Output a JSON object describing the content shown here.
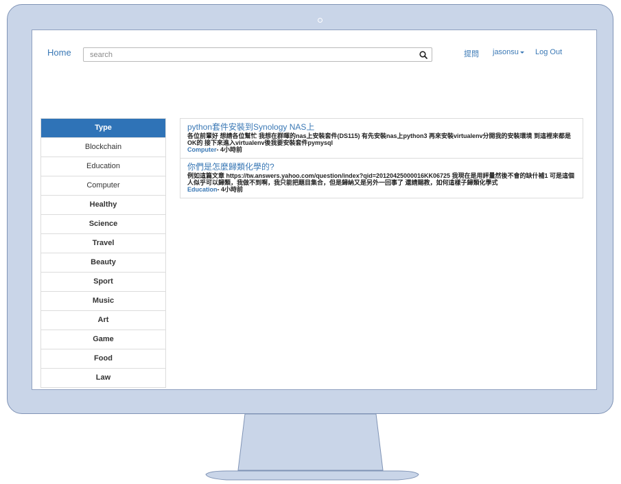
{
  "nav": {
    "home": "Home",
    "search_placeholder": "search",
    "ask": "提問",
    "user": "jasonsu",
    "logout": "Log Out"
  },
  "sidebar": {
    "header": "Type",
    "items": [
      {
        "label": "Blockchain",
        "bold": false
      },
      {
        "label": "Education",
        "bold": false
      },
      {
        "label": "Computer",
        "bold": false
      },
      {
        "label": "Healthy",
        "bold": true
      },
      {
        "label": "Science",
        "bold": true
      },
      {
        "label": "Travel",
        "bold": true
      },
      {
        "label": "Beauty",
        "bold": true
      },
      {
        "label": "Sport",
        "bold": true
      },
      {
        "label": "Music",
        "bold": true
      },
      {
        "label": "Art",
        "bold": true
      },
      {
        "label": "Game",
        "bold": true
      },
      {
        "label": "Food",
        "bold": true
      },
      {
        "label": "Law",
        "bold": true
      }
    ]
  },
  "questions": [
    {
      "title": "python套件安裝到Synology NAS上",
      "body": "各位前輩好 想請各位幫忙 我想在群暉的nas上安裝套件(DS115) 有先安裝nas上python3 再來安裝virtualenv分開我的安裝環境 到這裡來都是OK的 接下來進入virtualenv後我要安裝套件pymysql",
      "category": "Computer",
      "time": "- 4小時前"
    },
    {
      "title": "你們是怎麼歸類化學的?",
      "body": "例如這篇文章 https://tw.answers.yahoo.com/question/index?qid=20120425000016KK06725 我現在是用評量然後不會的缺什補1 可是這個人似乎可以歸類，我做不到啊，我只能把題目集合，但是歸納又是另外一回事了 還請賜教，如何這樣子歸類化學式",
      "category": "Education",
      "time": "- 4小時前"
    }
  ],
  "colors": {
    "accent": "#2f73b7",
    "link": "#3a78b5",
    "monitor": "#c9d5e8"
  }
}
